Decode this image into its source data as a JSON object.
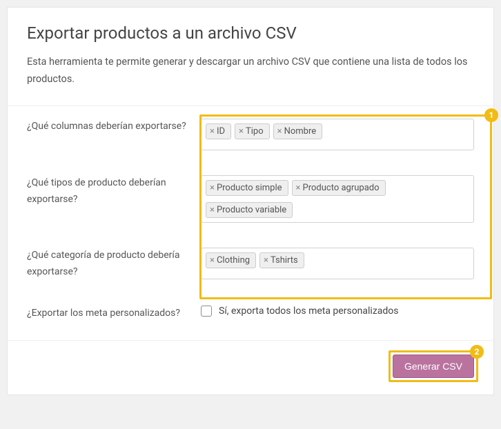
{
  "header": {
    "title": "Exportar productos a un archivo CSV",
    "description": "Esta herramienta te permite generar y descargar un archivo CSV que contiene una lista de todos los productos."
  },
  "fields": {
    "columns": {
      "label": "¿Qué columnas deberían exportarse?",
      "tags": [
        "ID",
        "Tipo",
        "Nombre"
      ]
    },
    "types": {
      "label": "¿Qué tipos de producto deberían exportarse?",
      "tags": [
        "Producto simple",
        "Producto agrupado",
        "Producto variable"
      ]
    },
    "categories": {
      "label": "¿Qué categoría de producto debería exportarse?",
      "tags": [
        "Clothing",
        "Tshirts"
      ]
    },
    "meta": {
      "label": "¿Exportar los meta personalizados?",
      "checkbox_label": "Sí, exporta todos los meta personalizados",
      "checked": false
    }
  },
  "footer": {
    "submit_label": "Generar CSV"
  },
  "annotations": {
    "marker1": "1",
    "marker2": "2"
  }
}
